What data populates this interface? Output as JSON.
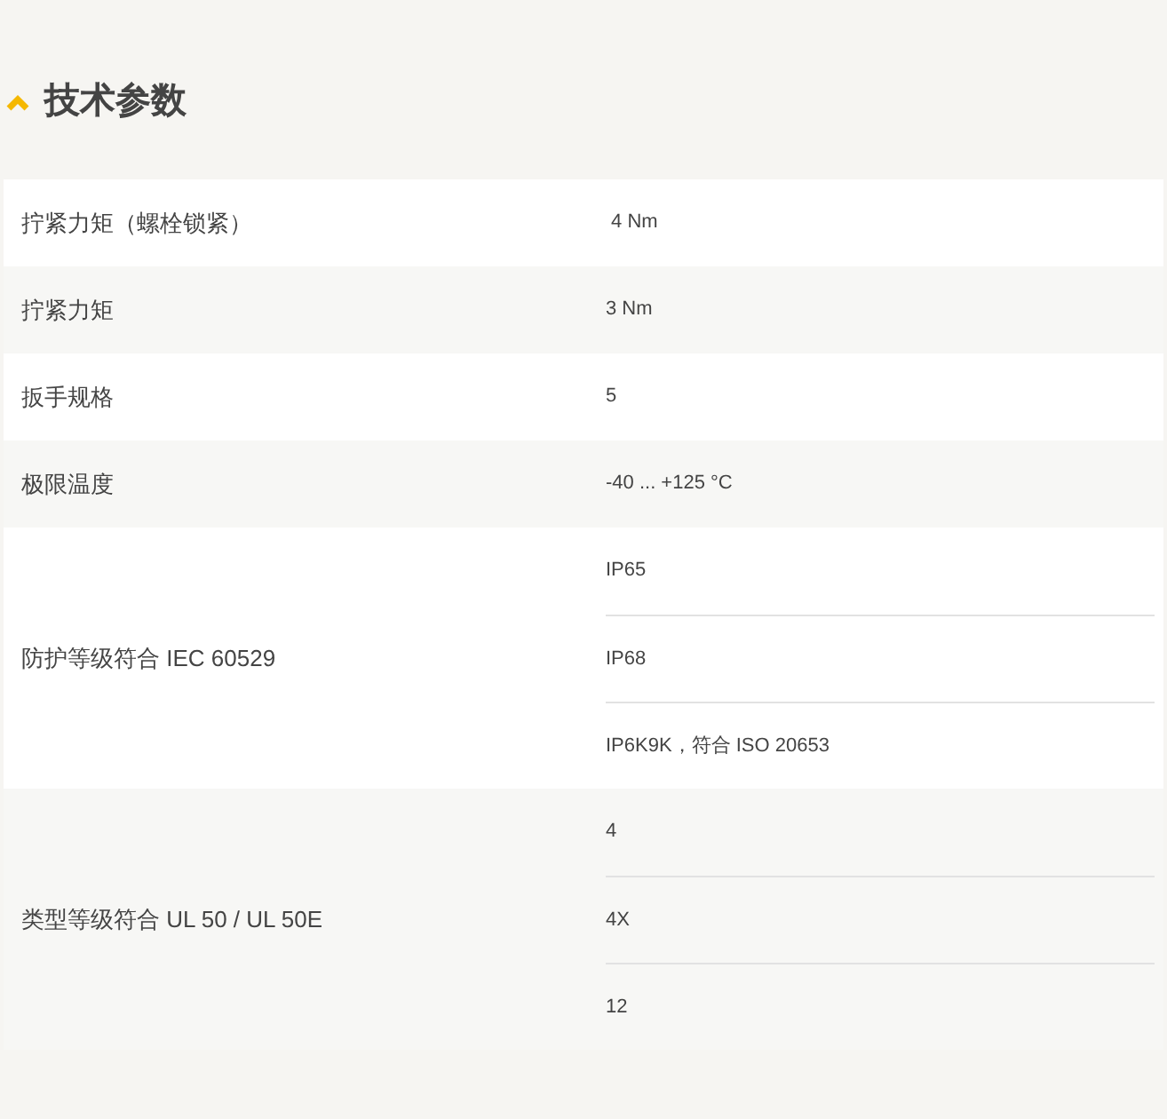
{
  "section": {
    "title": "技术参数",
    "expanded": true
  },
  "rows": [
    {
      "label": "拧紧力矩（螺栓锁紧）",
      "values": [
        " 4 Nm"
      ]
    },
    {
      "label": "拧紧力矩",
      "values": [
        "3 Nm"
      ]
    },
    {
      "label": "扳手规格",
      "values": [
        "5"
      ]
    },
    {
      "label": "极限温度",
      "values": [
        "-40 ... +125 °C"
      ]
    },
    {
      "label": "防护等级符合 IEC 60529",
      "values": [
        "IP65",
        "IP68",
        "IP6K9K，符合 ISO 20653"
      ]
    },
    {
      "label": "类型等级符合 UL 50 / UL 50E",
      "values": [
        "4",
        "4X",
        "12"
      ]
    }
  ]
}
